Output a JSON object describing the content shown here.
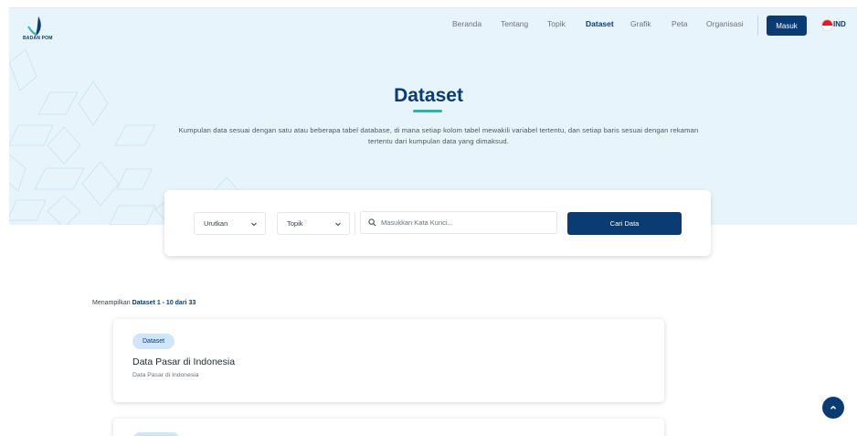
{
  "brand": {
    "logo_text": "BADAN POM"
  },
  "nav": {
    "items": [
      {
        "label": "Beranda",
        "active": false
      },
      {
        "label": "Tentang",
        "active": false
      },
      {
        "label": "Topik",
        "active": false
      },
      {
        "label": "Dataset",
        "active": true
      },
      {
        "label": "Grafik",
        "active": false
      },
      {
        "label": "Peta",
        "active": false
      },
      {
        "label": "Organisasi",
        "active": false
      }
    ],
    "login_label": "Masuk",
    "language": "IND"
  },
  "hero": {
    "title": "Dataset",
    "description": "Kumpulan data sesuai dengan satu atau beberapa tabel database, di mana setiap kolom tabel mewakili variabel tertentu, dan setiap baris sesuai dengan rekaman tertentu dari kumpulan data yang dimaksud."
  },
  "search": {
    "sort_label": "Urutkan",
    "topic_label": "Topik",
    "placeholder": "Masukkan Kata Kunci...",
    "value": "",
    "submit_label": "Cari Data"
  },
  "results": {
    "prefix": "Menampilkan ",
    "range": "Dataset 1 - 10 dari 33",
    "items": [
      {
        "badge": "Dataset",
        "title": "Data Pasar di Indonesia",
        "subtitle": "Data Pasar di Indonesia"
      }
    ]
  },
  "colors": {
    "primary": "#0b3b73",
    "accent": "#2bb5a6",
    "hero_bg": "#e8f4fb",
    "badge_bg": "#cfe6fa"
  },
  "icons": {
    "search": "search-icon",
    "chevron": "chevron-down-icon",
    "scroll_top": "chevron-up-icon"
  }
}
